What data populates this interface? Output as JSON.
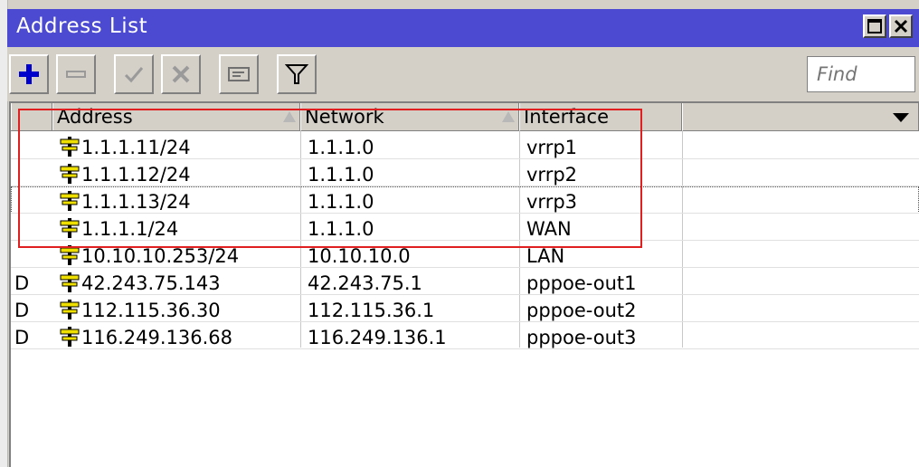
{
  "window": {
    "title": "Address List"
  },
  "toolbar": {
    "buttons": [
      "add-icon",
      "remove-icon",
      "enable-icon",
      "disable-icon",
      "comment-icon",
      "filter-icon"
    ],
    "find_placeholder": "Find"
  },
  "table": {
    "columns": [
      {
        "label": "Address",
        "sortable": true
      },
      {
        "label": "Network",
        "sortable": true
      },
      {
        "label": "Interface",
        "sortable": false
      }
    ],
    "rows": [
      {
        "flag": "",
        "address": "1.1.1.11/24",
        "network": "1.1.1.0",
        "interface": "vrrp1"
      },
      {
        "flag": "",
        "address": "1.1.1.12/24",
        "network": "1.1.1.0",
        "interface": "vrrp2"
      },
      {
        "flag": "",
        "address": "1.1.1.13/24",
        "network": "1.1.1.0",
        "interface": "vrrp3"
      },
      {
        "flag": "",
        "address": "1.1.1.1/24",
        "network": "1.1.1.0",
        "interface": "WAN"
      },
      {
        "flag": "",
        "address": "10.10.10.253/24",
        "network": "10.10.10.0",
        "interface": "LAN"
      },
      {
        "flag": "D",
        "address": "42.243.75.143",
        "network": "42.243.75.1",
        "interface": "pppoe-out1"
      },
      {
        "flag": "D",
        "address": "112.115.36.30",
        "network": "112.115.36.1",
        "interface": "pppoe-out2"
      },
      {
        "flag": "D",
        "address": "116.249.136.68",
        "network": "116.249.136.1",
        "interface": "pppoe-out3"
      }
    ]
  },
  "colors": {
    "titlebar": "#4b4ad1",
    "highlight_box": "#e02020",
    "address_icon": "#f0e000"
  }
}
